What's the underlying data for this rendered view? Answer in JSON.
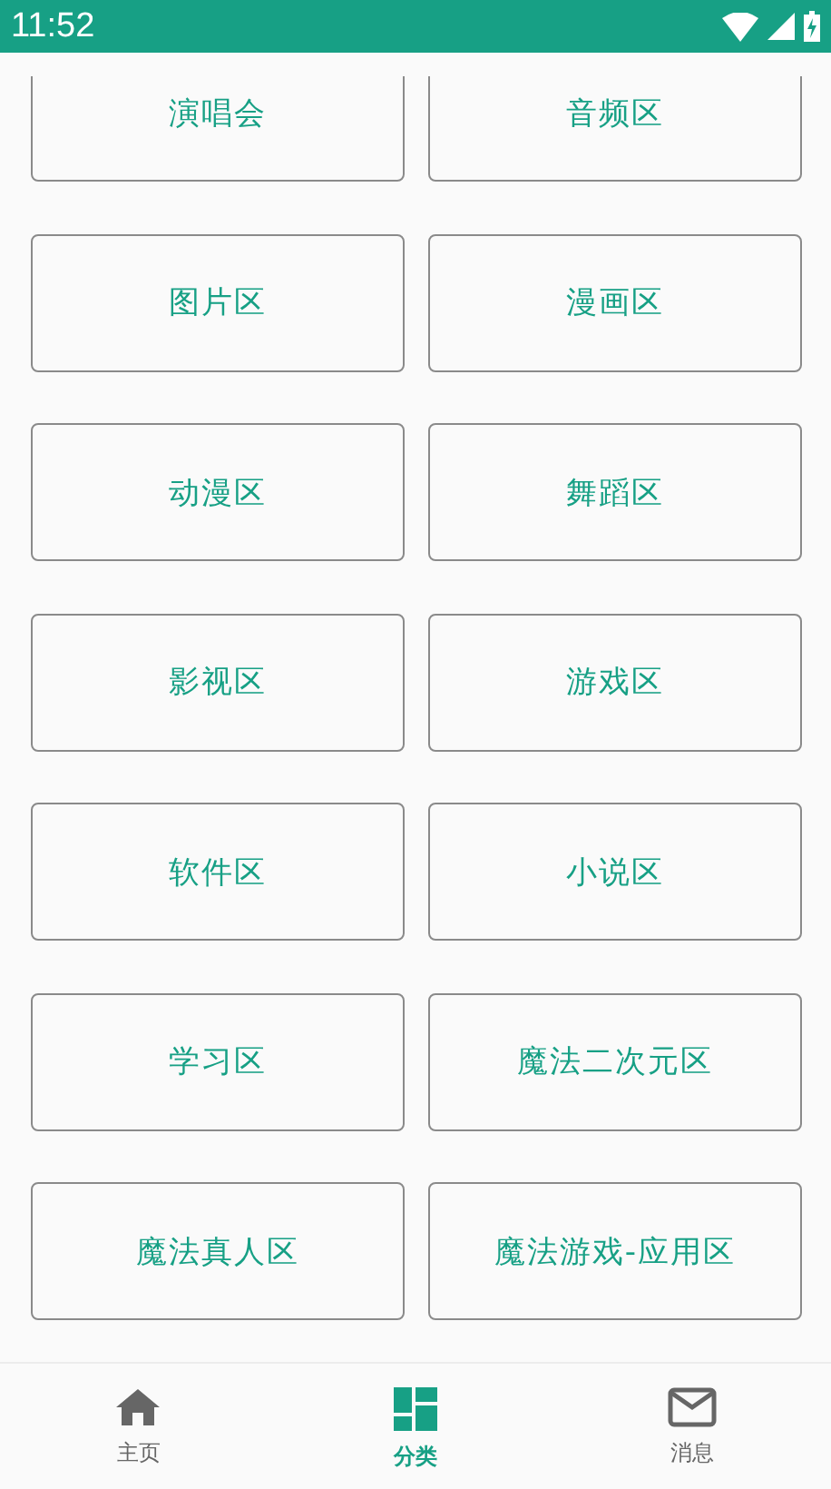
{
  "status_bar": {
    "time": "11:52"
  },
  "categories": [
    {
      "label": "演唱会"
    },
    {
      "label": "音频区"
    },
    {
      "label": "图片区"
    },
    {
      "label": "漫画区"
    },
    {
      "label": "动漫区"
    },
    {
      "label": "舞蹈区"
    },
    {
      "label": "影视区"
    },
    {
      "label": "游戏区"
    },
    {
      "label": "软件区"
    },
    {
      "label": "小说区"
    },
    {
      "label": "学习区"
    },
    {
      "label": "魔法二次元区"
    },
    {
      "label": "魔法真人区"
    },
    {
      "label": "魔法游戏-应用区"
    }
  ],
  "bottom_nav": [
    {
      "label": "主页",
      "kind": "home",
      "selected": false
    },
    {
      "label": "分类",
      "kind": "grid",
      "selected": true
    },
    {
      "label": "消息",
      "kind": "mail",
      "selected": false
    }
  ]
}
